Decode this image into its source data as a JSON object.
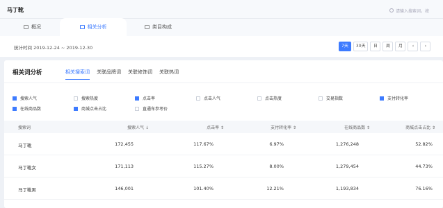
{
  "header": {
    "brand": "马丁靴",
    "search_placeholder": "请输入搜索词，按",
    "tabs": [
      "概况",
      "相关分析",
      "类目构成"
    ]
  },
  "datebar": {
    "range": "统计时间 2019-12-24 ~ 2019-12-30",
    "periods": [
      "7天",
      "30天",
      "日",
      "周",
      "月"
    ],
    "nav": [
      "‹",
      "›"
    ]
  },
  "panel": {
    "title": "相关词分析",
    "subtabs": [
      "相关搜索词",
      "关联品牌词",
      "关联修饰词",
      "关联热词"
    ],
    "filters": [
      {
        "label": "搜索人气",
        "checked": true
      },
      {
        "label": "搜索热度",
        "checked": false
      },
      {
        "label": "点击率",
        "checked": true
      },
      {
        "label": "点击人气",
        "checked": false
      },
      {
        "label": "点击热度",
        "checked": false
      },
      {
        "label": "交易指数",
        "checked": false
      },
      {
        "label": "支付转化率",
        "checked": true
      },
      {
        "label": "在线商品数",
        "checked": true
      },
      {
        "label": "商城点击占比",
        "checked": true
      },
      {
        "label": "直通车参考价",
        "checked": false
      }
    ],
    "columns": [
      "搜索词",
      "搜索人气 ↓",
      "点击率 ⇕",
      "支付转化率 ⇕",
      "在线商品数 ⇕",
      "商城点击占比 ⇕"
    ],
    "rows": [
      [
        "马丁靴",
        "172,455",
        "117.67%",
        "6.97%",
        "1,276,248",
        "52.82%"
      ],
      [
        "马丁靴女",
        "171,113",
        "115.27%",
        "8.00%",
        "1,279,454",
        "44.73%"
      ],
      [
        "马丁靴男",
        "146,001",
        "101.40%",
        "12.21%",
        "1,193,834",
        "76.16%"
      ]
    ]
  }
}
